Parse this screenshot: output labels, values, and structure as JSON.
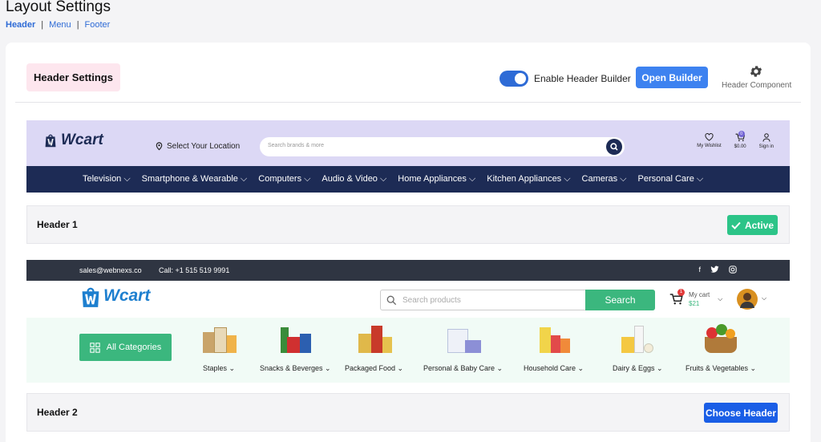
{
  "page": {
    "title": "Layout Settings"
  },
  "subnav": {
    "items": [
      "Header",
      "Menu",
      "Footer"
    ],
    "separator": "|"
  },
  "settings": {
    "badge": "Header Settings",
    "toggle_label": "Enable Header Builder",
    "toggle_on": true,
    "open_builder": "Open Builder",
    "component_label": "Header Component"
  },
  "header1": {
    "brand": "Wcart",
    "location": "Select Your Location",
    "search_placeholder": "Search brands & more",
    "wishlist": "My Wishlist",
    "cart_amount": "$0.00",
    "cart_count": "0",
    "signin": "Sign in",
    "nav": [
      "Television",
      "Smartphone & Wearable",
      "Computers",
      "Audio & Video",
      "Home Appliances",
      "Kitchen Appliances",
      "Cameras",
      "Personal Care"
    ],
    "label": "Header 1",
    "status": "Active"
  },
  "header2": {
    "email": "sales@webnexs.co",
    "phone": "Call: +1 515 519 9991",
    "brand": "Wcart",
    "search_placeholder": "Search products",
    "search_button": "Search",
    "cart_label": "My cart",
    "cart_price": "$21",
    "cart_count": "1",
    "all_categories": "All Categories",
    "categories": [
      "Staples",
      "Snacks & Beverges",
      "Packaged Food",
      "Personal & Baby Care",
      "Household Care",
      "Dairy & Eggs",
      "Fruits & Vegetables"
    ],
    "label": "Header 2",
    "choose": "Choose Header"
  },
  "colors": {
    "primary": "#3d82f0",
    "active": "#2cc488",
    "green": "#3bb77e",
    "navy": "#1d2b55"
  }
}
